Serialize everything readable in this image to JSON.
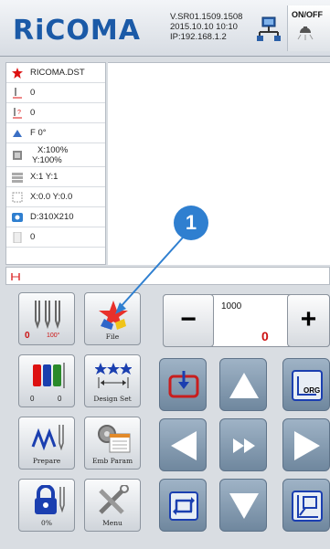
{
  "header": {
    "logo": "RiCOMA",
    "version": "V.SR01.1509.1508",
    "datetime": "2015.10.10   10:10",
    "ip": "IP:192.168.1.2",
    "onoff_label": "ON/OFF"
  },
  "info": {
    "file_name": "RICOMA.DST",
    "needle_value": "0",
    "stitch_value": "0",
    "rotation": "F   0°",
    "scale_x": "X:100%",
    "scale_y": "Y:100%",
    "repeat": "X:1      Y:1",
    "offset": "X:0.0   Y:0.0",
    "size": "D:310X210",
    "count": "0"
  },
  "buttons": {
    "needle_speed_left": "0",
    "needle_speed_right": "100°",
    "file": "File",
    "color_left": "0",
    "color_right": "0",
    "design_set": "Design Set",
    "prepare": "Prepare",
    "emb_param": "Emb Param",
    "lock_percent": "0%",
    "menu": "Menu"
  },
  "counter": {
    "minus": "−",
    "plus": "+",
    "top_value": "1000",
    "main_value": "0"
  },
  "callout": {
    "number": "1"
  },
  "colors": {
    "brand": "#1b5aa7",
    "callout": "#2f7fd0",
    "accent_red": "#cc1111"
  }
}
